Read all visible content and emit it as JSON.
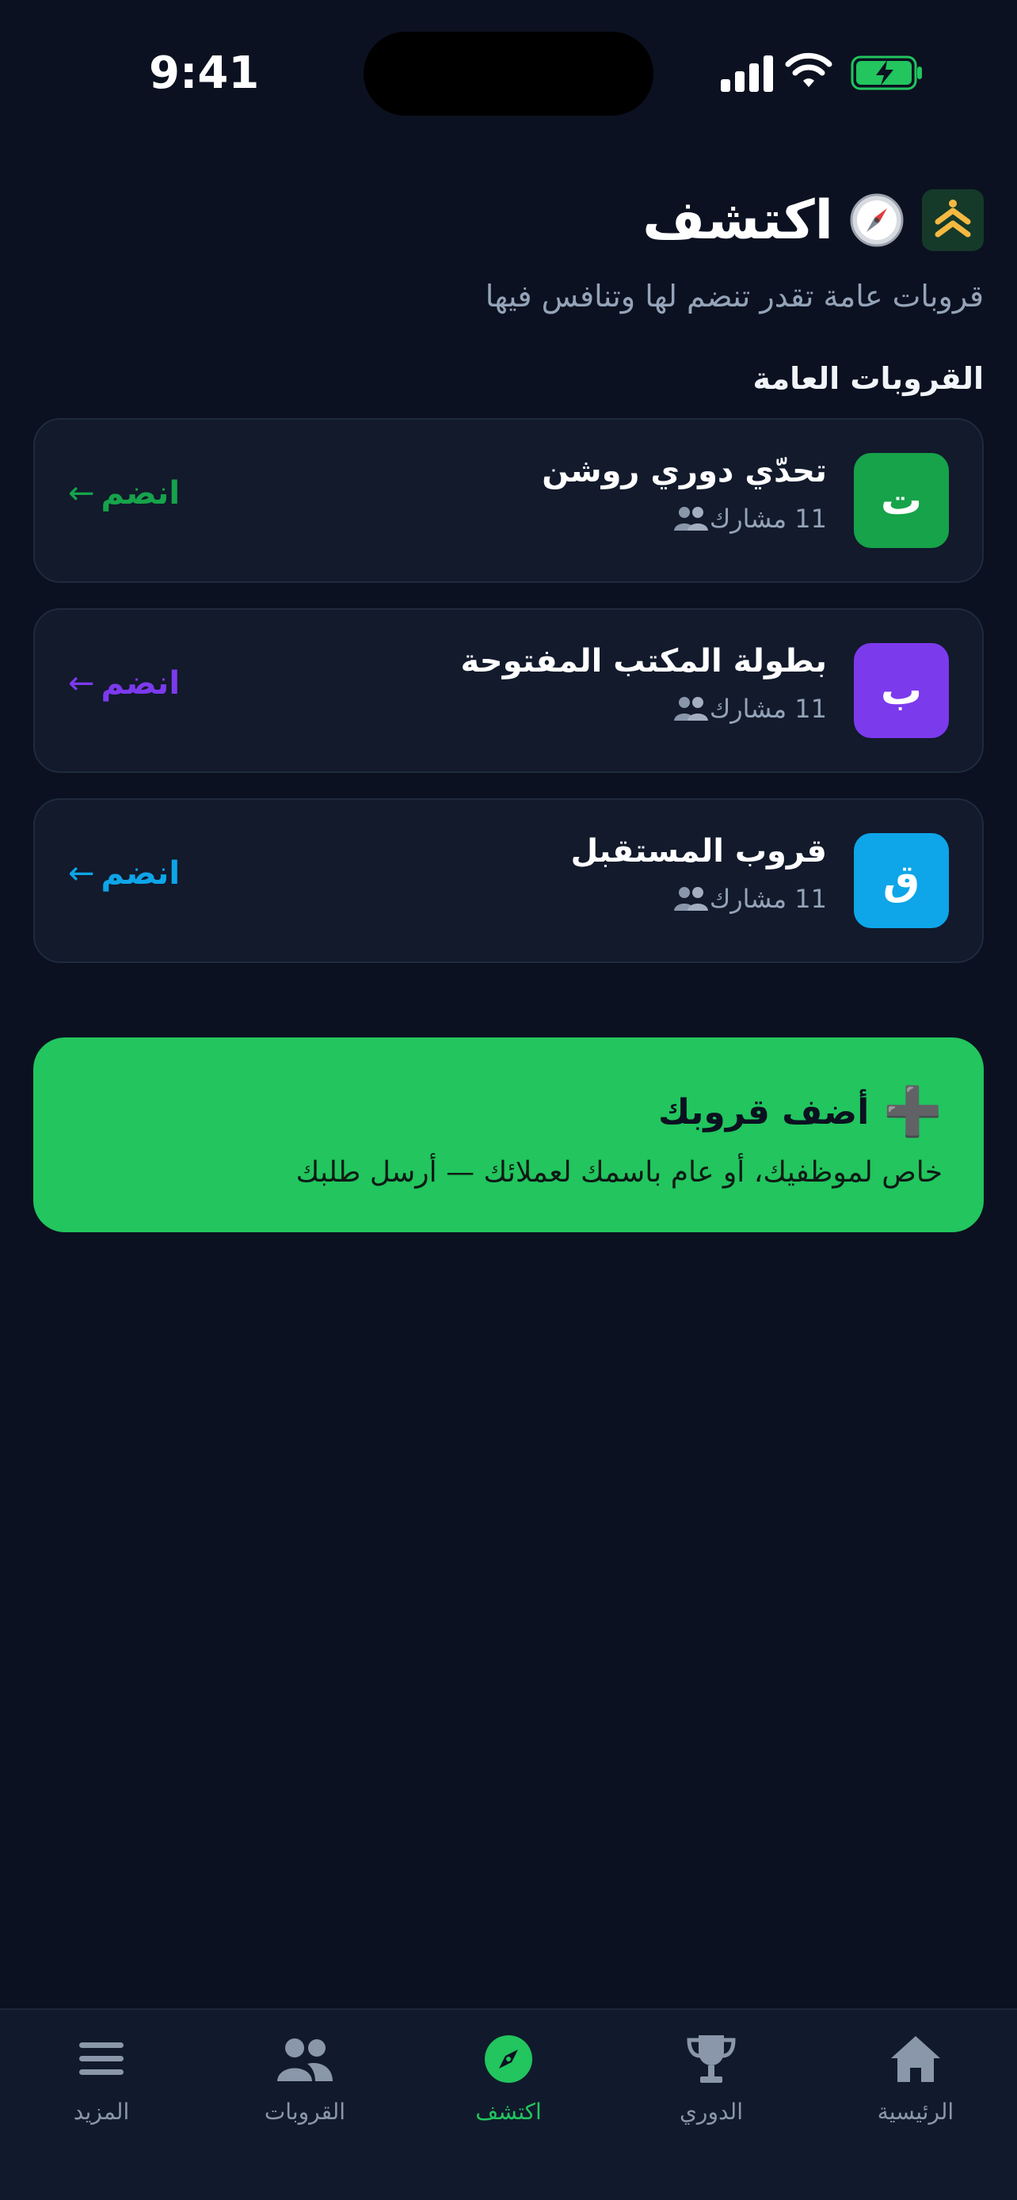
{
  "status_bar": {
    "time": "9:41"
  },
  "header": {
    "title": "اكتشف",
    "subtitle": "قروبات عامة تقدر تنضم لها وتنافس فيها"
  },
  "section": {
    "title": "القروبات العامة"
  },
  "groups": [
    {
      "initial": "ت",
      "name": "تحدّي دوري روشن",
      "participants": "11 مشارك",
      "join_label": "انضم",
      "arrow": "←",
      "color": "#16a34a"
    },
    {
      "initial": "ب",
      "name": "بطولة المكتب المفتوحة",
      "participants": "11 مشارك",
      "join_label": "انضم",
      "arrow": "←",
      "color": "#7c3aed"
    },
    {
      "initial": "ق",
      "name": "قروب المستقبل",
      "participants": "11 مشارك",
      "join_label": "انضم",
      "arrow": "←",
      "color": "#0ea5e9"
    }
  ],
  "cta": {
    "plus": "➕",
    "title": "أضف قروبك",
    "description": "خاص لموظفيك، أو عام باسمك لعملائك — أرسل طلبك"
  },
  "bottom_nav": [
    {
      "label": "الرئيسية",
      "icon": "home-icon"
    },
    {
      "label": "الدوري",
      "icon": "trophy-icon"
    },
    {
      "label": "اكتشف",
      "icon": "compass-icon",
      "active": true
    },
    {
      "label": "القروبات",
      "icon": "users-icon"
    },
    {
      "label": "المزيد",
      "icon": "menu-icon"
    }
  ],
  "colors": {
    "background": "#0b1120",
    "card": "#121a2c",
    "accent": "#22c55e",
    "muted": "#94a3b8"
  }
}
